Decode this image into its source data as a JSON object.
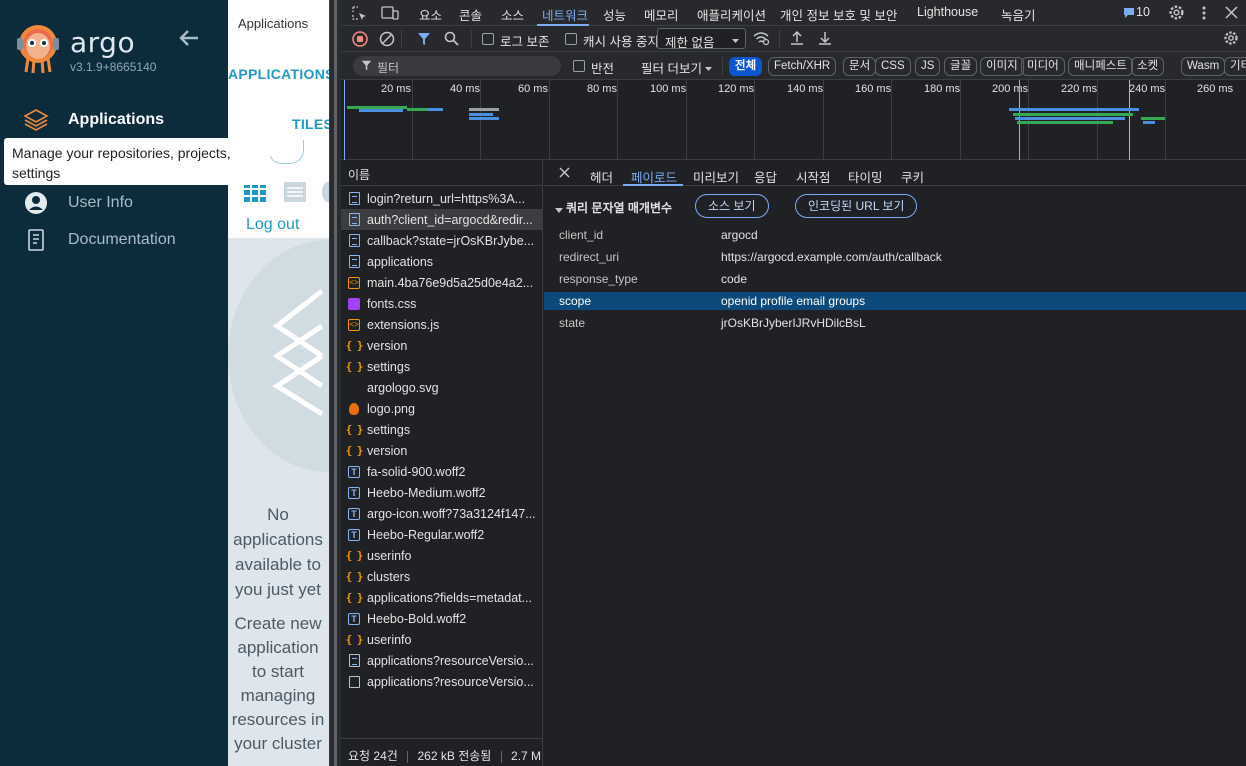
{
  "argo": {
    "brand": "argo",
    "version": "v3.1.9+8665140",
    "nav": [
      {
        "label": "Applications"
      },
      {
        "label": "User Info"
      },
      {
        "label": "Documentation"
      }
    ],
    "tooltip": "Manage your repositories, projects, settings",
    "main": {
      "page_title": "Applications",
      "applications_tab": "APPLICATIONS",
      "tiles_tab": "TILES",
      "logout": "Log out",
      "empty_title": "No applications available to you just yet",
      "empty_subtitle": "Create new application to start managing resources in your cluster"
    }
  },
  "devtools": {
    "tabs": [
      "요소",
      "콘솔",
      "소스",
      "네트워크",
      "성능",
      "메모리",
      "애플리케이션",
      "개인 정보 보호 및 보안",
      "Lighthouse",
      "녹음기"
    ],
    "selected_tab": "네트워크",
    "issues_count": "10",
    "toolbar": {
      "preserve_log": "로그 보존",
      "disable_cache": "캐시 사용 중지",
      "throttling": "제한 없음"
    },
    "filter": {
      "placeholder": "필터",
      "invert": "반전",
      "more_filters": "필터 더보기",
      "types": [
        "전체",
        "Fetch/XHR",
        "문서",
        "CSS",
        "JS",
        "글꼴",
        "이미지",
        "미디어",
        "매니페스트",
        "소켓",
        "Wasm",
        "기타"
      ],
      "selected_type": "전체"
    },
    "timeline": {
      "ticks": [
        "20 ms",
        "40 ms",
        "60 ms",
        "80 ms",
        "100 ms",
        "120 ms",
        "140 ms",
        "160 ms",
        "180 ms",
        "200 ms",
        "220 ms",
        "240 ms",
        "260 ms"
      ]
    },
    "requests": {
      "header": "이름",
      "items": [
        {
          "name": "login?return_url=https%3A...",
          "type": "doc"
        },
        {
          "name": "auth?client_id=argocd&redir...",
          "type": "doc"
        },
        {
          "name": "callback?state=jrOsKBrJybe...",
          "type": "doc"
        },
        {
          "name": "applications",
          "type": "doc"
        },
        {
          "name": "main.4ba76e9d5a25d0e4a2...",
          "type": "js"
        },
        {
          "name": "fonts.css",
          "type": "css"
        },
        {
          "name": "extensions.js",
          "type": "js"
        },
        {
          "name": "version",
          "type": "xhr"
        },
        {
          "name": "settings",
          "type": "xhr"
        },
        {
          "name": "argologo.svg",
          "type": "none"
        },
        {
          "name": "logo.png",
          "type": "img"
        },
        {
          "name": "settings",
          "type": "xhr"
        },
        {
          "name": "version",
          "type": "xhr"
        },
        {
          "name": "fa-solid-900.woff2",
          "type": "font"
        },
        {
          "name": "Heebo-Medium.woff2",
          "type": "font"
        },
        {
          "name": "argo-icon.woff?73a3124f147...",
          "type": "font"
        },
        {
          "name": "Heebo-Regular.woff2",
          "type": "font"
        },
        {
          "name": "userinfo",
          "type": "xhr"
        },
        {
          "name": "clusters",
          "type": "xhr"
        },
        {
          "name": "applications?fields=metadat...",
          "type": "xhr"
        },
        {
          "name": "Heebo-Bold.woff2",
          "type": "font"
        },
        {
          "name": "userinfo",
          "type": "xhr"
        },
        {
          "name": "applications?resourceVersio...",
          "type": "blank"
        },
        {
          "name": "applications?resourceVersio...",
          "type": "blank2"
        }
      ],
      "selected_index": 1
    },
    "status": {
      "requests": "요청 24건",
      "transferred": "262 kB 전송됨",
      "resources": "2.7 M"
    },
    "detail_tabs": [
      "헤더",
      "페이로드",
      "미리보기",
      "응답",
      "시작점",
      "타이밍",
      "쿠키"
    ],
    "selected_detail_tab": "페이로드",
    "payload": {
      "section": "쿼리 문자열 매개변수",
      "view_source": "소스 보기",
      "view_encoded": "인코딩된 URL 보기",
      "params": [
        {
          "key": "client_id",
          "value": "argocd"
        },
        {
          "key": "redirect_uri",
          "value": "https://argocd.example.com/auth/callback"
        },
        {
          "key": "response_type",
          "value": "code"
        },
        {
          "key": "scope",
          "value": "openid profile email groups"
        },
        {
          "key": "state",
          "value": "jrOsKBrJyberIJRvHDilcBsL"
        }
      ],
      "selected_param": "scope"
    },
    "colors": {
      "accent": "#7cacf8",
      "selected_row": "#0b4a7b",
      "argo_sidebar": "#0d2c3b"
    }
  }
}
